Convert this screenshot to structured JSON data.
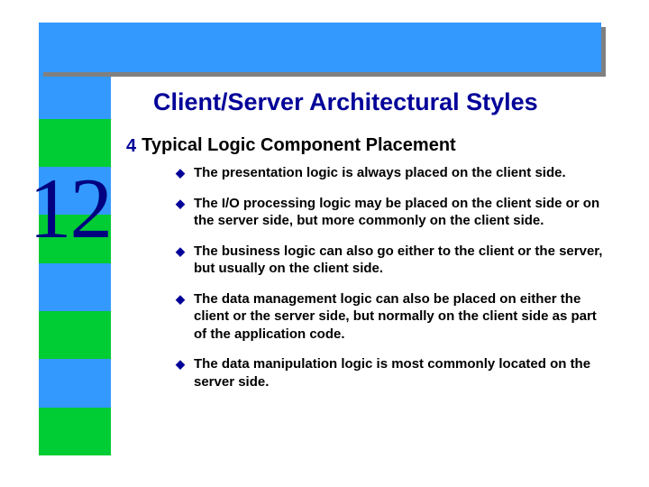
{
  "slide_number": "12",
  "title": "Client/Server Architectural Styles",
  "heading": "Typical Logic Component Placement",
  "bullets": [
    {
      "pre": "The ",
      "bold": "presentation logic",
      "post": " is always placed on the client side."
    },
    {
      "pre": "The ",
      "bold": "I/O processing logic",
      "post": " may be placed on the client side or on the server side, but more commonly on the client side."
    },
    {
      "pre": "The ",
      "bold": "business logic",
      "post": " can also go either to the client or the server, but usually on the client side."
    },
    {
      "pre": "The ",
      "bold": "data management logic",
      "post": " can also be placed on either the client or the server side, but normally on the client side as part of the application code."
    },
    {
      "pre": "The ",
      "bold": "data manipulation logic",
      "post": " is most commonly located on the server side."
    }
  ],
  "colors": {
    "top_band": "#3399ff",
    "accent": "#000099",
    "bar_green": "#00cc33",
    "bar_blue": "#3399ff"
  }
}
